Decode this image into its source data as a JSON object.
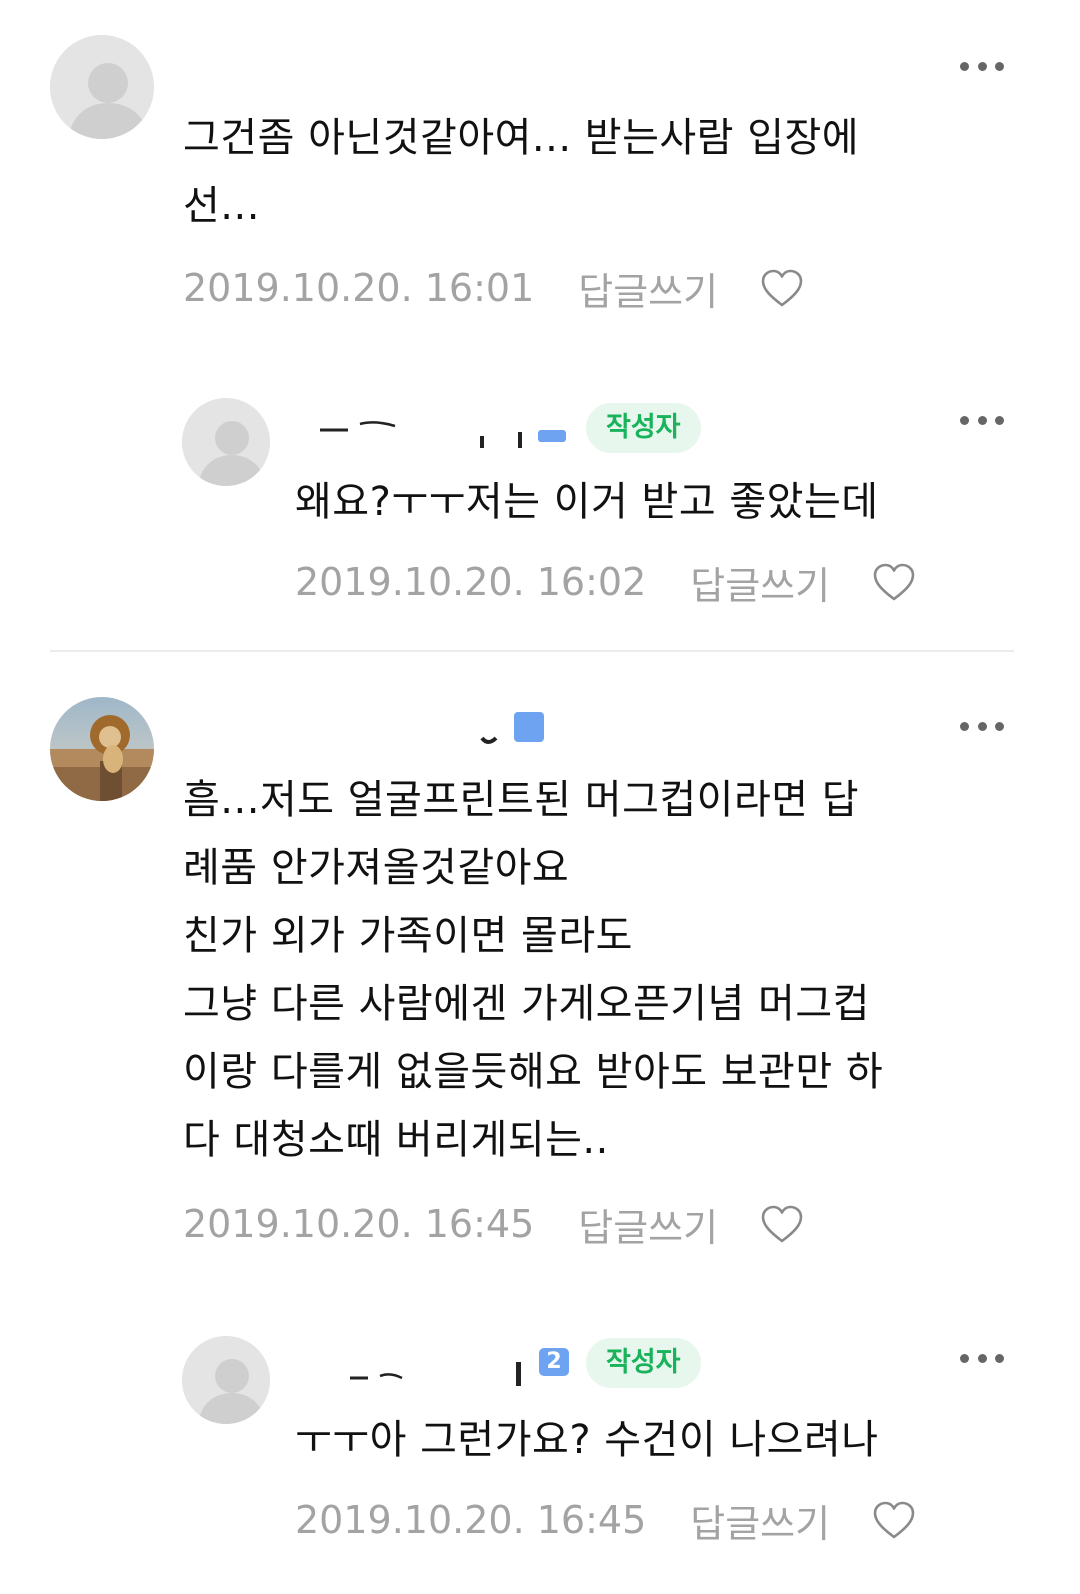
{
  "comments": [
    {
      "nickname": "",
      "is_author": false,
      "text_lines": [
        "그건좀 아닌것같아여... 받는사람 입장에",
        "선..."
      ],
      "date": "2019.10.20. 16:01",
      "reply_label": "답글쓰기"
    },
    {
      "nickname": "",
      "grade": "",
      "is_author": true,
      "author_label": "작성자",
      "text_lines": [
        "왜요?ㅜㅜ저는 이거 받고 좋았는데"
      ],
      "date": "2019.10.20. 16:02",
      "reply_label": "답글쓰기"
    },
    {
      "nickname": "",
      "grade": "",
      "is_author": false,
      "text_lines": [
        "흠...저도 얼굴프린트된 머그컵이라면 답",
        "례품 안가져올것같아요",
        "친가 외가 가족이면 몰라도",
        "그냥 다른 사람에겐 가게오픈기념 머그컵",
        "이랑 다를게 없을듯해요 받아도 보관만 하",
        "다 대청소때 버리게되는.."
      ],
      "date": "2019.10.20. 16:45",
      "reply_label": "답글쓰기"
    },
    {
      "nickname": "",
      "grade": "2",
      "is_author": true,
      "author_label": "작성자",
      "text_lines": [
        "ㅜㅜ아 그런가요? 수건이 나으려나"
      ],
      "date": "2019.10.20. 16:45",
      "reply_label": "답글쓰기"
    }
  ],
  "icons": {
    "more": "more-options-icon",
    "like": "heart-icon",
    "avatar_default": "default-profile-icon",
    "avatar_photo": "lion-cat-profile-photo"
  },
  "colors": {
    "meta_text": "#a3a3a3",
    "author_badge_bg": "#e8f7ee",
    "author_badge_text": "#19b35c",
    "grade_badge": "#6ea3f2",
    "divider": "#ececec"
  }
}
